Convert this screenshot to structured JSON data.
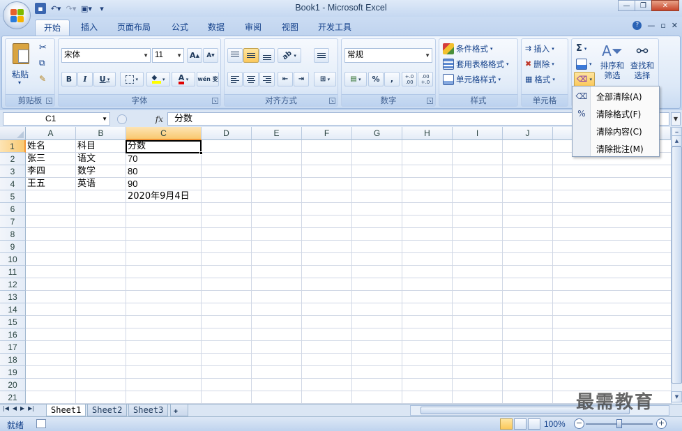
{
  "window": {
    "title": "Book1 - Microsoft Excel"
  },
  "tabs": [
    "开始",
    "插入",
    "页面布局",
    "公式",
    "数据",
    "审阅",
    "视图",
    "开发工具"
  ],
  "active_tab": "开始",
  "clipboard": {
    "paste_label": "粘贴",
    "group_label": "剪贴板"
  },
  "font": {
    "name": "宋体",
    "size": "11",
    "grow": "A",
    "shrink": "A",
    "bold": "B",
    "italic": "I",
    "underline": "U",
    "font_color_glyph": "A",
    "phonetic_glyph": "wén 变",
    "group_label": "字体"
  },
  "alignment": {
    "group_label": "对齐方式"
  },
  "number": {
    "format": "常规",
    "percent": "%",
    "comma": ",",
    "inc_decimal": "+.0 .00",
    "dec_decimal": ".00 +.0",
    "group_label": "数字"
  },
  "styles": {
    "conditional": "条件格式",
    "table": "套用表格格式",
    "cell": "单元格样式",
    "group_label": "样式"
  },
  "cells_group": {
    "insert": "插入",
    "delete": "删除",
    "format": "格式",
    "group_label": "单元格"
  },
  "editing": {
    "sigma": "Σ",
    "sort_filter": "排序和筛选",
    "find_select": "查找和选择",
    "sort_line1": "排序和",
    "sort_line2": "筛选",
    "find_line1": "查找和",
    "find_line2": "选择"
  },
  "clear_menu": {
    "items": [
      {
        "label": "全部清除(A)"
      },
      {
        "label": "清除格式(F)"
      },
      {
        "label": "清除内容(C)"
      },
      {
        "label": "清除批注(M)"
      }
    ]
  },
  "formula_bar": {
    "name_box": "C1",
    "fx": "fx",
    "content": "分数"
  },
  "columns": [
    "A",
    "B",
    "C",
    "D",
    "E",
    "F",
    "G",
    "H",
    "I",
    "J"
  ],
  "rows": [
    "1",
    "2",
    "3",
    "4",
    "5",
    "6",
    "7",
    "8",
    "9",
    "10",
    "11",
    "12",
    "13",
    "14",
    "15",
    "16",
    "17",
    "18",
    "19",
    "20",
    "21"
  ],
  "cells": {
    "A1": "姓名",
    "B1": "科目",
    "C1": "分数",
    "A2": "张三",
    "B2": "语文",
    "C2": "70",
    "A3": "李四",
    "B3": "数学",
    "C3": "80",
    "A4": "王五",
    "B4": "英语",
    "C4": "90",
    "C5": "2020年9月4日"
  },
  "sheets": [
    "Sheet1",
    "Sheet2",
    "Sheet3"
  ],
  "active_sheet": "Sheet1",
  "status": {
    "ready": "就绪",
    "zoom": "100%",
    "minus": "−",
    "plus": "+"
  },
  "watermark": "最需教育",
  "colors": {
    "accent": "#15428b",
    "selection": "#f9c971"
  }
}
